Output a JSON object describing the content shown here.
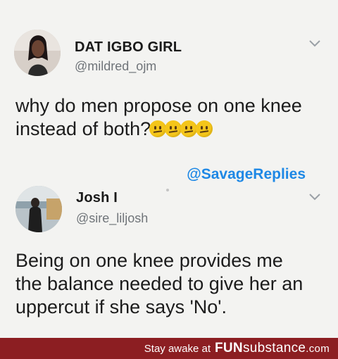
{
  "tweets": [
    {
      "name": "DAT IGBO GIRL",
      "handle": "@mildred_ojm",
      "text_line1": "why do men propose on one knee",
      "text_line2": "instead of both?",
      "emoji_icon": "confused-face-emoji",
      "emoji_count": 4
    },
    {
      "name": "Josh I",
      "handle": "@sire_liljosh",
      "text_line1": "Being on one knee provides me",
      "text_line2": "the balance needed to give her an",
      "text_line3": "uppercut if she says 'No'."
    }
  ],
  "watermark": "@SavageReplies",
  "footer": {
    "prefix": "Stay awake at",
    "site_bold": "FUN",
    "site_rest": "substance",
    "site_suffix": ".com"
  },
  "colors": {
    "background": "#f3f3f1",
    "watermark": "#1e88e5",
    "footer_bg": "#8c1e22"
  }
}
